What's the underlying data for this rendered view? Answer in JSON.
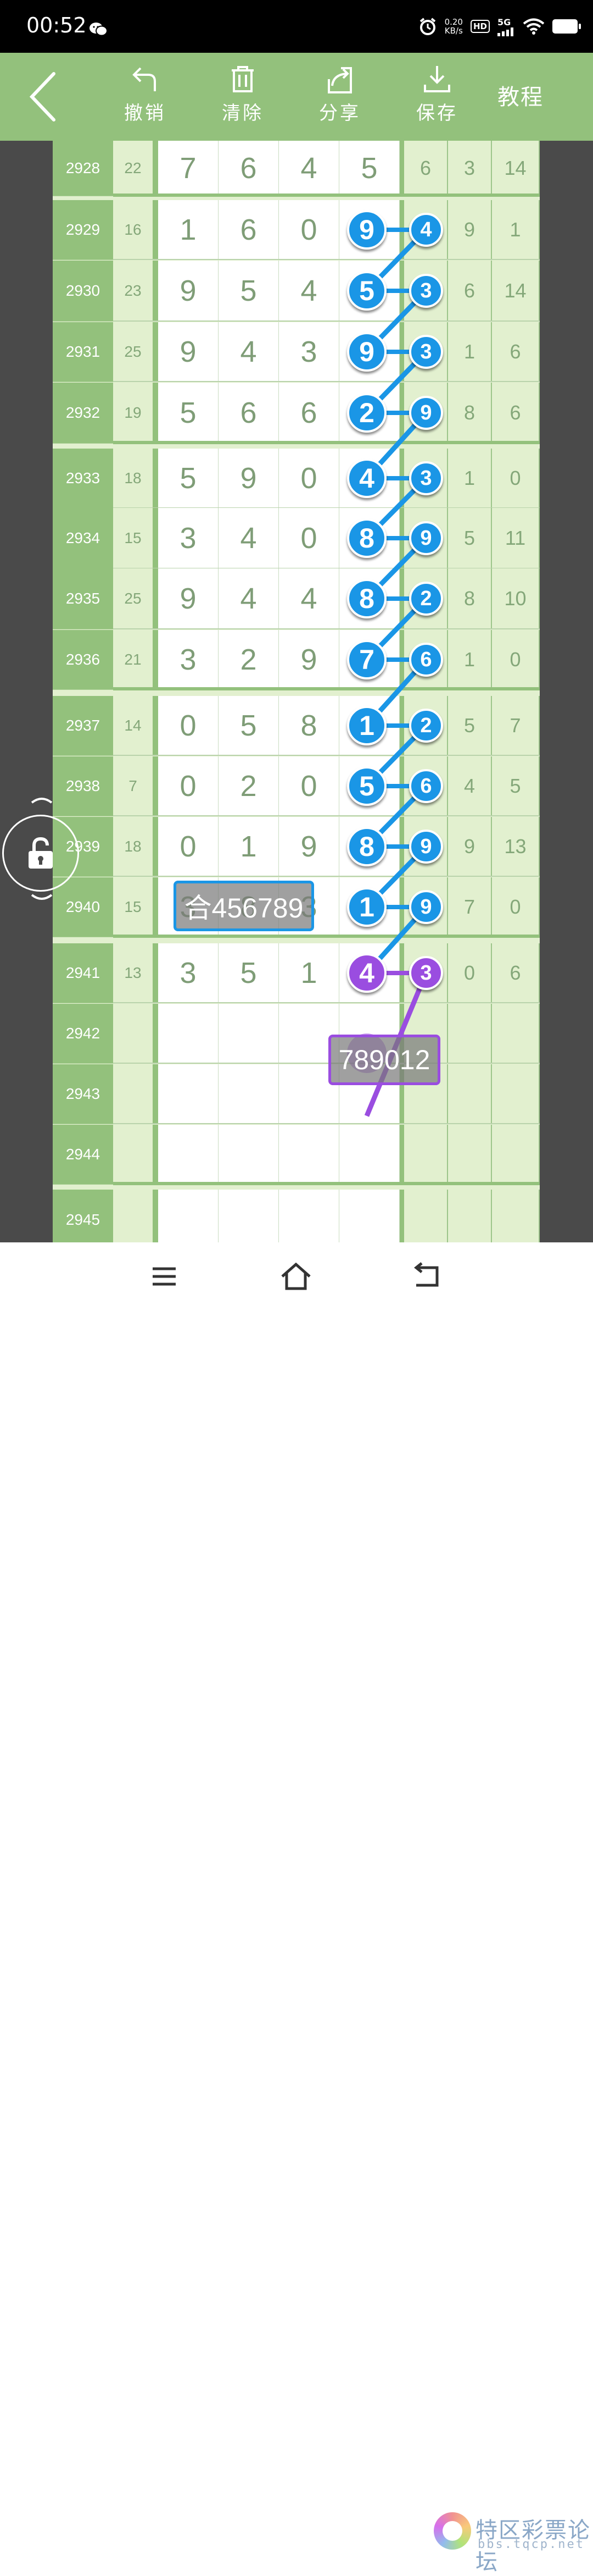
{
  "status_bar": {
    "time": "00:52",
    "net_speed_value": "0.20",
    "net_speed_unit": "KB/s",
    "hd": "HD",
    "network": "5G"
  },
  "toolbar": {
    "undo_label": "撤销",
    "clear_label": "清除",
    "share_label": "分享",
    "save_label": "保存",
    "tutorial_label": "教程"
  },
  "rows": [
    {
      "period": "2928",
      "sum": "22",
      "digits": [
        "7",
        "6",
        "4",
        "5"
      ],
      "small": [
        "6",
        "3",
        "14"
      ]
    },
    {
      "period": "2929",
      "sum": "16",
      "digits": [
        "1",
        "6",
        "0",
        ""
      ],
      "small": [
        "",
        "9",
        "1"
      ]
    },
    {
      "period": "2930",
      "sum": "23",
      "digits": [
        "9",
        "5",
        "4",
        ""
      ],
      "small": [
        "",
        "6",
        "14"
      ]
    },
    {
      "period": "2931",
      "sum": "25",
      "digits": [
        "9",
        "4",
        "3",
        ""
      ],
      "small": [
        "",
        "1",
        "6"
      ]
    },
    {
      "period": "2932",
      "sum": "19",
      "digits": [
        "5",
        "6",
        "6",
        ""
      ],
      "small": [
        "",
        "8",
        "6"
      ]
    },
    {
      "period": "2933",
      "sum": "18",
      "digits": [
        "5",
        "9",
        "0",
        ""
      ],
      "small": [
        "",
        "1",
        "0"
      ]
    },
    {
      "period": "2934",
      "sum": "15",
      "digits": [
        "3",
        "4",
        "0",
        ""
      ],
      "small": [
        "",
        "5",
        "11"
      ]
    },
    {
      "period": "2935",
      "sum": "25",
      "digits": [
        "9",
        "4",
        "4",
        ""
      ],
      "small": [
        "",
        "8",
        "10"
      ]
    },
    {
      "period": "2936",
      "sum": "21",
      "digits": [
        "3",
        "2",
        "9",
        ""
      ],
      "small": [
        "",
        "1",
        "0"
      ]
    },
    {
      "period": "2937",
      "sum": "14",
      "digits": [
        "0",
        "5",
        "8",
        ""
      ],
      "small": [
        "",
        "5",
        "7"
      ]
    },
    {
      "period": "2938",
      "sum": "7",
      "digits": [
        "0",
        "2",
        "0",
        ""
      ],
      "small": [
        "",
        "4",
        "5"
      ]
    },
    {
      "period": "2939",
      "sum": "18",
      "digits": [
        "0",
        "1",
        "9",
        ""
      ],
      "small": [
        "",
        "9",
        "13"
      ]
    },
    {
      "period": "2940",
      "sum": "15",
      "digits": [
        "3",
        "8",
        "3",
        ""
      ],
      "small": [
        "",
        "7",
        "0"
      ]
    },
    {
      "period": "2941",
      "sum": "13",
      "digits": [
        "3",
        "5",
        "1",
        ""
      ],
      "small": [
        "",
        "0",
        "6"
      ]
    },
    {
      "period": "2942",
      "sum": "",
      "digits": [
        "",
        "",
        "",
        ""
      ],
      "small": [
        "",
        "",
        ""
      ]
    },
    {
      "period": "2943",
      "sum": "",
      "digits": [
        "",
        "",
        "",
        ""
      ],
      "small": [
        "",
        "",
        ""
      ]
    },
    {
      "period": "2944",
      "sum": "",
      "digits": [
        "",
        "",
        "",
        ""
      ],
      "small": [
        "",
        "",
        ""
      ]
    },
    {
      "period": "2945",
      "sum": "",
      "digits": [
        "",
        "",
        "",
        ""
      ],
      "small": [
        "",
        "",
        ""
      ]
    }
  ],
  "circled_pairs": [
    {
      "big": "9",
      "small": "4",
      "color": "blue"
    },
    {
      "big": "5",
      "small": "3",
      "color": "blue"
    },
    {
      "big": "9",
      "small": "3",
      "color": "blue"
    },
    {
      "big": "2",
      "small": "9",
      "color": "blue"
    },
    {
      "big": "4",
      "small": "3",
      "color": "blue"
    },
    {
      "big": "8",
      "small": "9",
      "color": "blue"
    },
    {
      "big": "8",
      "small": "2",
      "color": "blue"
    },
    {
      "big": "7",
      "small": "6",
      "color": "blue"
    },
    {
      "big": "1",
      "small": "2",
      "color": "blue"
    },
    {
      "big": "5",
      "small": "6",
      "color": "blue"
    },
    {
      "big": "8",
      "small": "9",
      "color": "blue"
    },
    {
      "big": "1",
      "small": "9",
      "color": "blue"
    },
    {
      "big": "4",
      "small": "3",
      "color": "purple"
    }
  ],
  "tags": {
    "blue_tag": "合456789",
    "purple_tag": "789012"
  },
  "colors": {
    "header_green": "#93c17c",
    "light_green": "#e2f0cf",
    "blue": "#1a96e6",
    "purple": "#9a4de0"
  },
  "watermark": {
    "title": "特区彩票论坛",
    "subtitle": "bbs.tqcp.net"
  }
}
